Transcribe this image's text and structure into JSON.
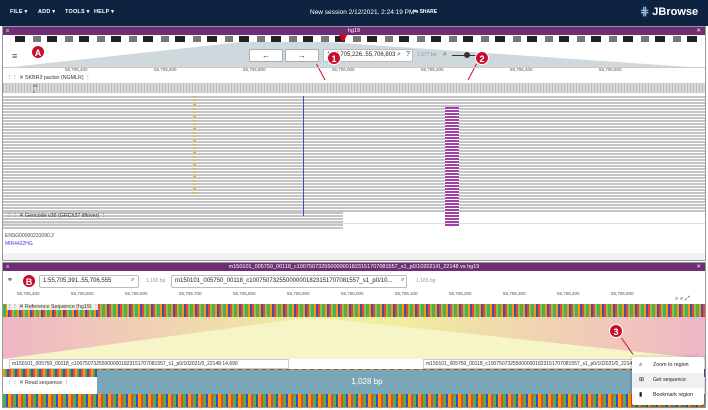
{
  "appbar": {
    "menus": [
      "FILE",
      "ADD",
      "TOOLS",
      "HELP"
    ],
    "session_title": "New session 2/12/2021, 2:24:19 PM",
    "share_label": "SHARE",
    "logo_text": "JBrowse"
  },
  "view1": {
    "title": "hg19",
    "marker": "A",
    "location": "1:55,705,226..55,706,803",
    "bp_count": "1,577 bp",
    "ruler_ticks": [
      "55,705,400",
      "55,705,600",
      "55,705,800",
      "55,706,000",
      "55,706,200",
      "55,706,400",
      "55,706,600"
    ],
    "alignment_track_label": "SKBR3 pacbio (NGMLR)",
    "coverage_max": "45",
    "coverage_min": "0",
    "gene_track_label": "Gencode v36 (GRCh37 liftover)",
    "gene_id": "ENSG00000231090.2",
    "gene_name": "MIR4422HG",
    "annotations": [
      "1",
      "2"
    ]
  },
  "view2": {
    "title": "m150101_005750_00118_c100750732550000001823151707081557_s1_p0/102021/0_22148 vs hg19",
    "marker": "B",
    "ref_location": "1:55,705,391..55,706,555",
    "ref_bp": "1,165 bp",
    "read_location": "m150101_005750_00118_c100750732550000001823151707081557_s1_p0/10...",
    "read_bp": "1,165 bp",
    "ruler_ticks": [
      "55,705,400",
      "55,705,500",
      "55,705,600",
      "55,705,700",
      "55,705,800",
      "55,705,900",
      "55,706,000",
      "55,706,100",
      "55,706,200",
      "55,706,300",
      "55,706,400",
      "55,706,500"
    ],
    "ref_track_label": "Reference Sequence (hg19)",
    "read_label_left": "m150101_005750_00118_c100750732550000001823151707081557_s1_p0/102021/0_22148:14,690",
    "read_label_right": "m150101_005750_00118_c100750732550000001823151707081557_s1_p0/102021/0_22148:15,850",
    "read_track_label": "Read sequence",
    "region_length": "1,028 bp",
    "annotation": "3"
  },
  "context_menu": {
    "items": [
      "Zoom to region",
      "Get sequence",
      "Bookmark region"
    ]
  },
  "colors": {
    "appbar": "#0d233f",
    "view_header": "#6f2d75",
    "marker": "#c80d2e",
    "synteny_yellow": "#f1ef9e",
    "synteny_pink": "#efb6c6"
  }
}
